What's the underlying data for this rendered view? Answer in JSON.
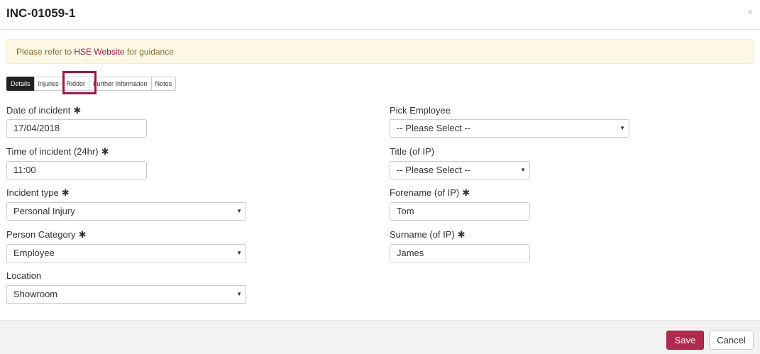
{
  "modal": {
    "title": "INC-01059-1",
    "close_label": "×"
  },
  "alert": {
    "prefix": "Please refer to ",
    "link": "HSE Website",
    "suffix": " for guidance"
  },
  "tabs": [
    {
      "label": "Details",
      "active": true
    },
    {
      "label": "Injuries"
    },
    {
      "label": "Riddor"
    },
    {
      "label": "Further Information"
    },
    {
      "label": "Notes"
    }
  ],
  "required_marker": "✱",
  "left": {
    "date": {
      "label": "Date of incident",
      "value": "17/04/2018"
    },
    "time": {
      "label": "Time of incident (24hr)",
      "value": "11:00"
    },
    "incident_type": {
      "label": "Incident type",
      "value": "Personal Injury"
    },
    "person_category": {
      "label": "Person Category",
      "value": "Employee"
    },
    "location": {
      "label": "Location",
      "value": "Showroom"
    }
  },
  "right": {
    "pick_employee": {
      "label": "Pick Employee",
      "value": "-- Please Select --"
    },
    "title_ip": {
      "label": "Title (of IP)",
      "value": "-- Please Select --"
    },
    "forename": {
      "label": "Forename (of IP)",
      "value": "Tom"
    },
    "surname": {
      "label": "Surname (of IP)",
      "value": "James"
    }
  },
  "footer": {
    "save_label": "Save",
    "cancel_label": "Cancel"
  },
  "colors": {
    "brand": "#b5284e",
    "alert_bg": "#fcf8e3",
    "highlight": "#a01650"
  }
}
